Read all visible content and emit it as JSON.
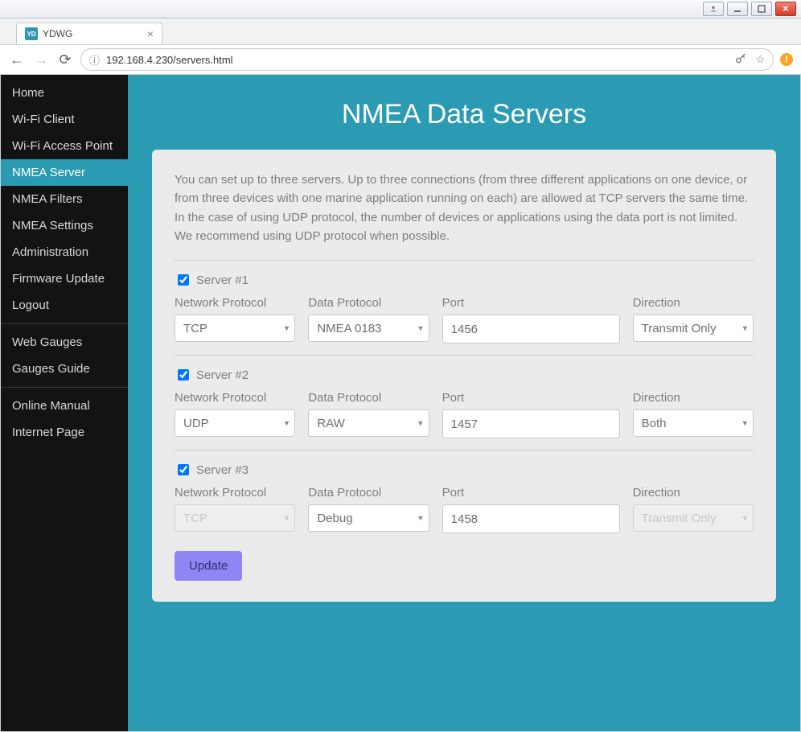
{
  "window": {
    "tab_title": "YDWG"
  },
  "address": "192.168.4.230/servers.html",
  "sidebar": {
    "groups": [
      [
        "Home",
        "Wi-Fi Client",
        "Wi-Fi Access Point",
        "NMEA Server",
        "NMEA Filters",
        "NMEA Settings",
        "Administration",
        "Firmware Update",
        "Logout"
      ],
      [
        "Web Gauges",
        "Gauges Guide"
      ],
      [
        "Online Manual",
        "Internet Page"
      ]
    ],
    "active": "NMEA Server"
  },
  "page": {
    "title": "NMEA Data Servers",
    "intro": "You can set up to three servers. Up to three connections (from three different applications on one device, or from three devices with one marine application running on each) are allowed at TCP servers the same time. In the case of using UDP protocol, the number of devices or applications using the data port is not limited. We recommend using UDP protocol when possible.",
    "labels": {
      "net": "Network Protocol",
      "data": "Data Protocol",
      "port": "Port",
      "dir": "Direction"
    },
    "servers": [
      {
        "name": "Server #1",
        "enabled": true,
        "net": "TCP",
        "data": "NMEA 0183",
        "port": "1456",
        "dir": "Transmit Only",
        "net_disabled": false,
        "dir_disabled": false
      },
      {
        "name": "Server #2",
        "enabled": true,
        "net": "UDP",
        "data": "RAW",
        "port": "1457",
        "dir": "Both",
        "net_disabled": false,
        "dir_disabled": false
      },
      {
        "name": "Server #3",
        "enabled": true,
        "net": "TCP",
        "data": "Debug",
        "port": "1458",
        "dir": "Transmit Only",
        "net_disabled": true,
        "dir_disabled": true
      }
    ],
    "update": "Update"
  }
}
